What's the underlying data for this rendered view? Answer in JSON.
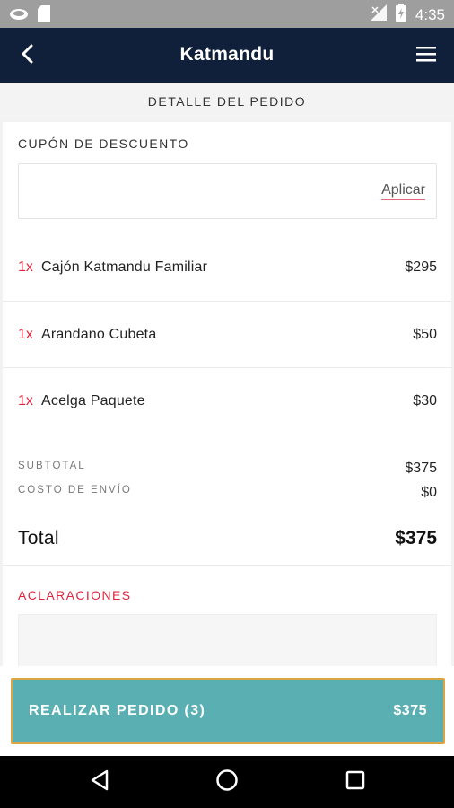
{
  "status_bar": {
    "time": "4:35",
    "left_icons": [
      "cloud-icon",
      "sd-card-icon"
    ],
    "right_icons": [
      "signal-icon",
      "battery-icon"
    ]
  },
  "app_bar": {
    "title": "Katmandu",
    "back_icon": "back-arrow-icon",
    "menu_icon": "hamburger-menu-icon"
  },
  "section_title": "DETALLE DEL PEDIDO",
  "coupon": {
    "label": "CUPÓN DE DESCUENTO",
    "input_value": "",
    "apply_label": "Aplicar"
  },
  "items": [
    {
      "qty": "1x",
      "name": "Cajón Katmandu Familiar",
      "price": "$295"
    },
    {
      "qty": "1x",
      "name": "Arandano Cubeta",
      "price": "$50"
    },
    {
      "qty": "1x",
      "name": "Acelga Paquete",
      "price": "$30"
    }
  ],
  "summary": {
    "subtotal_label": "SUBTOTAL",
    "subtotal_value": "$375",
    "shipping_label": "COSTO DE ENVÍO",
    "shipping_value": "$0",
    "total_label": "Total",
    "total_value": "$375"
  },
  "notes": {
    "label": "ACLARACIONES",
    "value": ""
  },
  "order_button": {
    "label": "REALIZAR PEDIDO (3)",
    "total": "$375"
  },
  "colors": {
    "app_bar": "#10203a",
    "accent_red": "#e0243e",
    "order_button": "#5aafb3",
    "order_border": "#d9a441"
  }
}
